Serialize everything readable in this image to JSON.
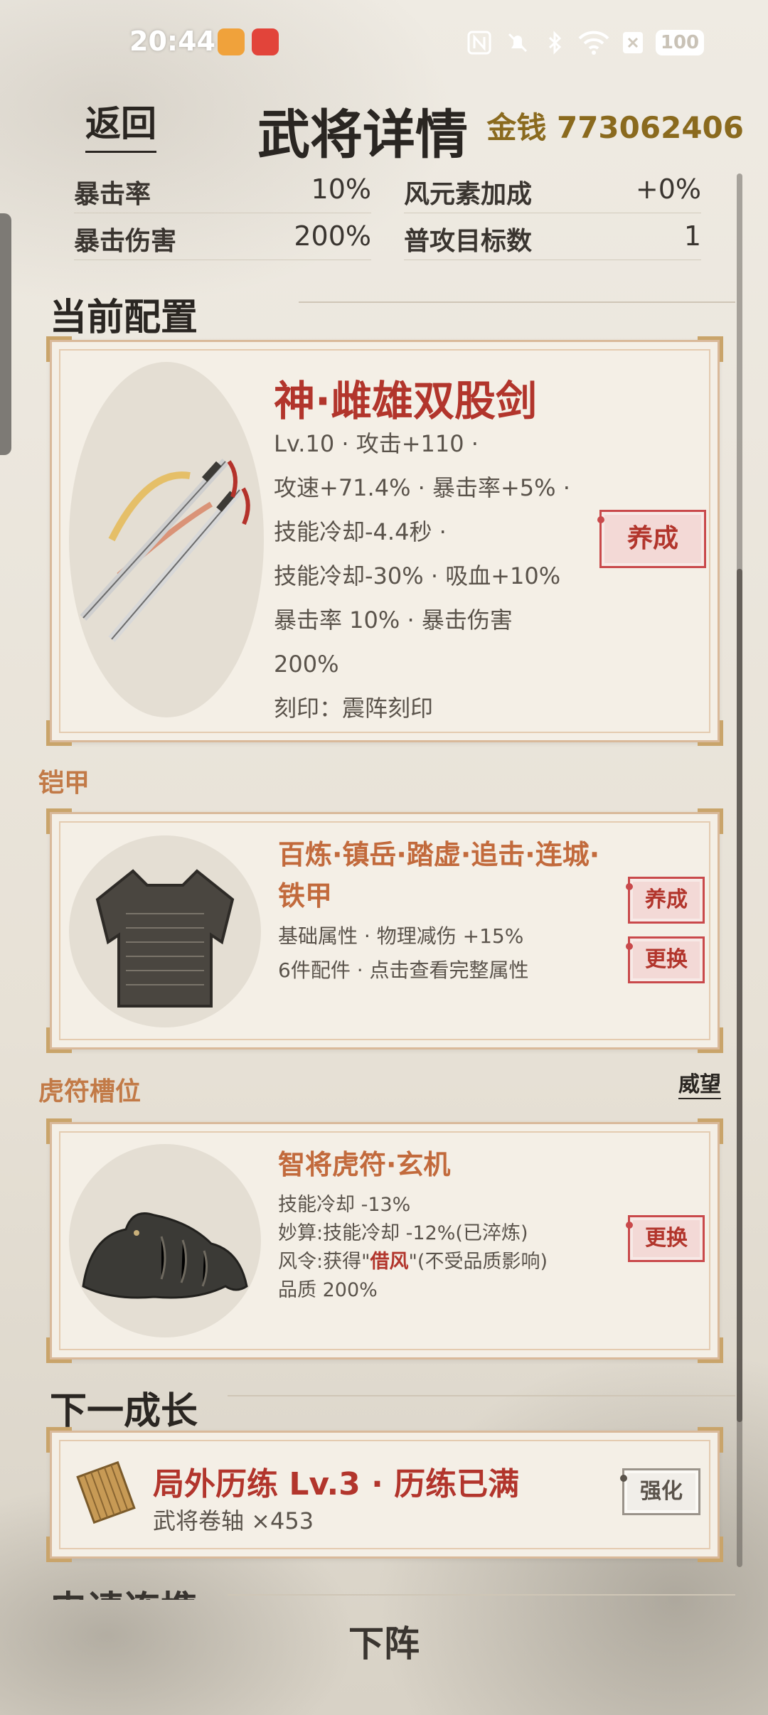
{
  "status_bar": {
    "time": "20:44",
    "battery": "100",
    "icons": [
      "nfc-icon",
      "mute-icon",
      "bluetooth-icon",
      "wifi-icon",
      "sim-off-icon"
    ]
  },
  "header": {
    "back_label": "返回",
    "title": "武将详情",
    "money_label": "金钱",
    "money_value": "773062406"
  },
  "stats": [
    {
      "label": "暴击率",
      "value": "10%"
    },
    {
      "label": "风元素加成",
      "value": "+0%"
    },
    {
      "label": "暴击伤害",
      "value": "200%"
    },
    {
      "label": "普攻目标数",
      "value": "1"
    }
  ],
  "current_config": {
    "title": "当前配置",
    "weapon": {
      "name": "神·雌雄双股剑",
      "lines": [
        "Lv.10 · 攻击+110 ·",
        "攻速+71.4% · 暴击率+5% ·",
        "技能冷却-4.4秒 ·",
        "技能冷却-30% · 吸血+10%",
        "暴击率 10% · 暴击伤害",
        "200%",
        "刻印：震阵刻印"
      ],
      "cultivate_label": "养成"
    }
  },
  "armor": {
    "section_label": "铠甲",
    "name_line1": "百炼·镇岳·踏虚·追击·连城·",
    "name_line2": "铁甲",
    "line1": "基础属性 · 物理减伤 +15%",
    "line2": "6件配件 · 点击查看完整属性",
    "cultivate_label": "养成",
    "replace_label": "更换"
  },
  "tally": {
    "section_label": "虎符槽位",
    "prestige_link": "威望",
    "name": "智将虎符·玄机",
    "line1": "技能冷却 -13%",
    "line2": "妙算:技能冷却 -12%(已淬炼)",
    "line3_prefix": "风令:获得\"",
    "line3_highlight": "借风",
    "line3_suffix": "\"(不受品质影响)",
    "line4": "品质 200%",
    "replace_label": "更换"
  },
  "next_growth": {
    "title": "下一成长",
    "name": "局外历练 Lv.3 · 历练已满",
    "sub": "武将卷轴 ×453",
    "enhance_label": "强化"
  },
  "partial_next_section": "申请连携",
  "bottom_button": "下阵",
  "colors": {
    "accent_red": "#b2352c",
    "accent_orange": "#c26a3c",
    "gold": "#8a6a1e",
    "card_border": "#d9b99a"
  }
}
